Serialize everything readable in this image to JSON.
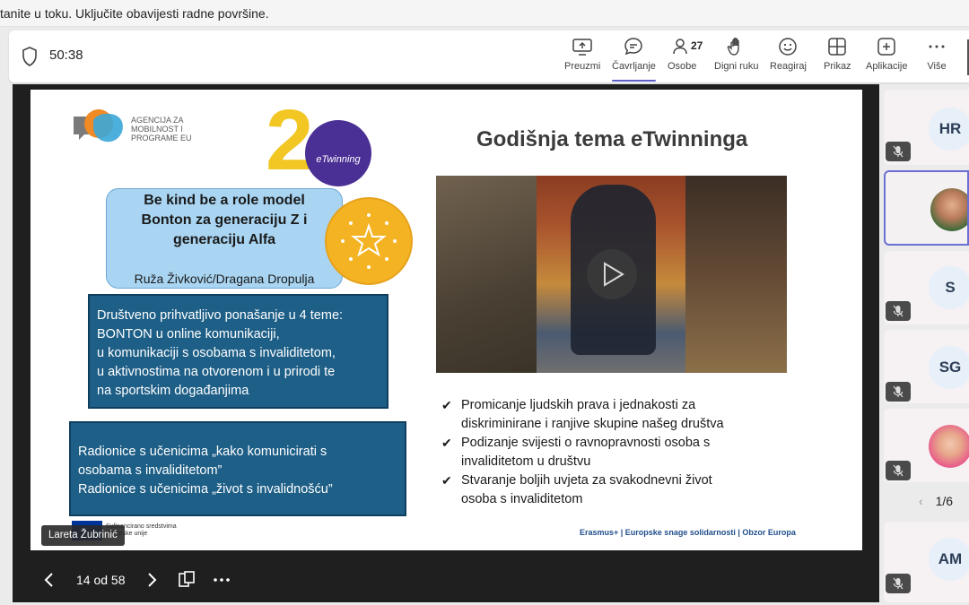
{
  "notification": {
    "text": "tanite u toku. Uključite obavijesti radne površine."
  },
  "toolbar": {
    "timer": "50:38",
    "buttons": [
      {
        "label": "Preuzmi",
        "icon": "share-screen-icon"
      },
      {
        "label": "Čavrljanje",
        "icon": "chat-icon",
        "active": true
      },
      {
        "label": "Osobe",
        "icon": "people-icon",
        "count": "27"
      },
      {
        "label": "Digni ruku",
        "icon": "raise-hand-icon"
      },
      {
        "label": "Reagiraj",
        "icon": "smile-icon"
      },
      {
        "label": "Prikaz",
        "icon": "view-grid-icon"
      },
      {
        "label": "Aplikacije",
        "icon": "add-app-icon"
      },
      {
        "label": "Više",
        "icon": "more-icon"
      }
    ],
    "accent_color": "#5b5fc7"
  },
  "slide": {
    "agency_text": "AGENCIJA ZA MOBILNOST I PROGRAME EU",
    "etwinning_text": "eTwinning",
    "etwinning_number": "2",
    "title_lines": [
      "Be kind be a role model",
      "Bonton za generaciju Z i",
      "generaciju Alfa"
    ],
    "authors": "Ruža Živković/Dragana Dropulja",
    "box1_lines": [
      "Društveno prihvatljivo ponašanje u 4 teme:",
      "BONTON u online komunikaciji,",
      "u komunikaciji s osobama s invaliditetom,",
      "u aktivnostima na otvorenom i u prirodi te",
      "na sportskim događanjima"
    ],
    "box2_lines": [
      "Radionice s učenicima „kako komunicirati s",
      "osobama s invaliditetom”",
      "Radionice s učenicima „život s invalidnošću”"
    ],
    "eu_text": "Sufinancirano sredstvima Europske unije",
    "heading": "Godišnja tema eTwinninga",
    "bullets": [
      [
        "Promicanje ljudskih prava i jednakosti za",
        "diskriminirane i ranjive skupine našeg društva"
      ],
      [
        "Podizanje svijesti o ravnopravnosti osoba s",
        "invaliditetom  u društvu"
      ],
      [
        "Stvaranje boljih uvjeta za svakodnevni život",
        "osoba s invaliditetom"
      ]
    ],
    "footer": "Erasmus+  |  Europske snage solidarnosti  |  Obzor Europa",
    "box_color": "#1e5f87",
    "title_box_color": "#a9d5f2",
    "badge_color": "#f4b323"
  },
  "presenter": {
    "name": "Lareta Žubrinić"
  },
  "controls": {
    "page_indicator": "14 od 58"
  },
  "participants": {
    "tiles": [
      {
        "initials": "HR",
        "muted": true
      },
      {
        "initials": "",
        "photo": true,
        "muted": false
      },
      {
        "initials": "S",
        "muted": true
      },
      {
        "initials": "SG",
        "muted": true
      },
      {
        "initials": "",
        "photo": true,
        "muted": true
      },
      {
        "initials": "AM",
        "muted": true
      }
    ],
    "pager": "1/6"
  }
}
